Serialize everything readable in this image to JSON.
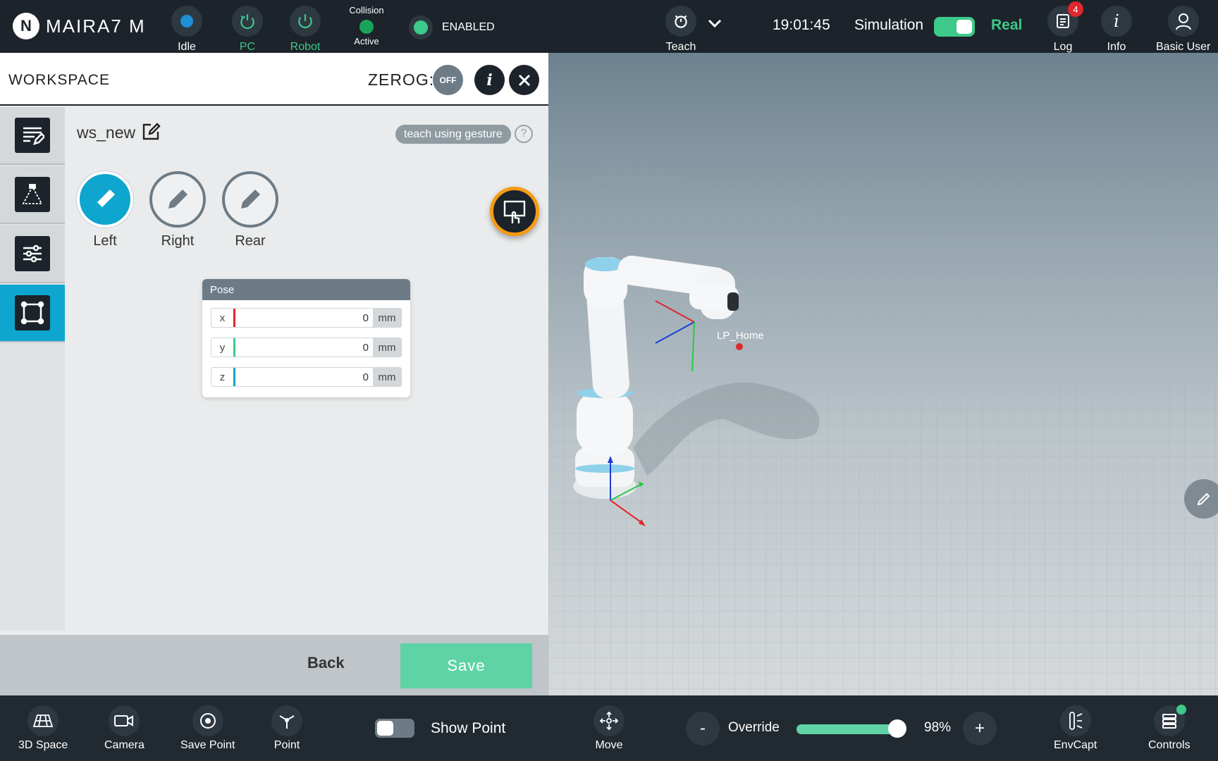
{
  "colors": {
    "accent_blue": "#0ea5cf",
    "accent_green": "#3dc98a",
    "gesture_ring": "#f59b12",
    "topbar_bg": "#1c232a"
  },
  "topbar": {
    "brand": "MAIRA7 M",
    "logo_glyph": "N",
    "status_items": [
      {
        "label": "Idle",
        "icon": "status-dot-icon"
      },
      {
        "label": "PC",
        "icon": "power-refresh-icon"
      },
      {
        "label": "Robot",
        "icon": "power-icon"
      }
    ],
    "collision": {
      "title": "Collision",
      "status": "Active"
    },
    "enabled_label": "ENABLED",
    "teach_label": "Teach",
    "time": "19:01:45",
    "simulation_label": "Simulation",
    "real_label": "Real",
    "log": {
      "label": "Log",
      "badge": "4"
    },
    "info_label": "Info",
    "user_label": "Basic User"
  },
  "panel": {
    "title": "WORKSPACE",
    "zerog_label": "ZEROG:",
    "zerog_state": "OFF",
    "workspace_name": "ws_new",
    "gesture_chip": "teach using gesture",
    "help_glyph": "?",
    "views": [
      {
        "label": "Left",
        "active": true
      },
      {
        "label": "Right",
        "active": false
      },
      {
        "label": "Rear",
        "active": false
      }
    ],
    "pose": {
      "title": "Pose",
      "rows": [
        {
          "axis": "x",
          "value": "0",
          "unit": "mm",
          "color": "#e0262f"
        },
        {
          "axis": "y",
          "value": "0",
          "unit": "mm",
          "color": "#3dc98a"
        },
        {
          "axis": "z",
          "value": "0",
          "unit": "mm",
          "color": "#0ea5cf"
        }
      ]
    },
    "back_label": "Back",
    "save_label": "Save"
  },
  "scene": {
    "point_label": "LP_Home"
  },
  "bottombar": {
    "items_left": [
      {
        "label": "3D Space",
        "icon": "grid-3d-icon"
      },
      {
        "label": "Camera",
        "icon": "camera-icon"
      },
      {
        "label": "Save Point",
        "icon": "target-icon"
      },
      {
        "label": "Point",
        "icon": "point-pin-icon"
      }
    ],
    "show_point_label": "Show Point",
    "move_label": "Move",
    "override_label": "Override",
    "override_minus": "-",
    "override_plus": "+",
    "override_percent": 98,
    "override_text": "98%",
    "envcapt_label": "EnvCapt",
    "controls_label": "Controls"
  }
}
